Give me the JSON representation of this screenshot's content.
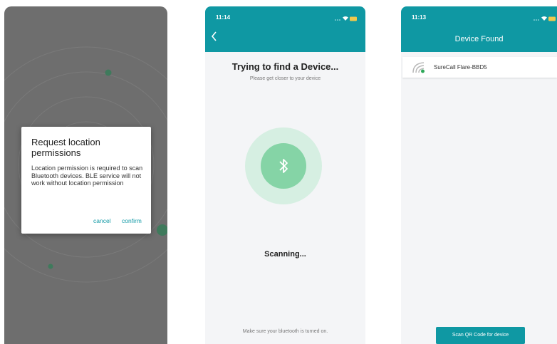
{
  "screen1": {
    "dialog": {
      "title": "Request location permissions",
      "message": "Location permission is required to scan Bluetooth devices. BLE service will not work without location permission",
      "cancel_label": "cancel",
      "confirm_label": "confirm"
    }
  },
  "screen2": {
    "status_time": "11:14",
    "back_icon": "chevron-left-icon",
    "title": "Trying to find a Device...",
    "subtitle": "Please get closer to your device",
    "center_icon": "bluetooth-icon",
    "status_text": "Scanning...",
    "footer_note": "Make sure your bluetooth is turned on."
  },
  "screen3": {
    "status_time": "11:13",
    "title": "Device Found",
    "devices": [
      {
        "name": "SureCall Flare-BBD5",
        "icon": "signal-strength-icon"
      }
    ],
    "scan_qr_label": "Scan QR Code for device"
  },
  "colors": {
    "primary": "#0f98a3",
    "accent_green": "#85d4a6",
    "ring_green": "#d6efe2",
    "dim_overlay": "#6e6e6e"
  }
}
